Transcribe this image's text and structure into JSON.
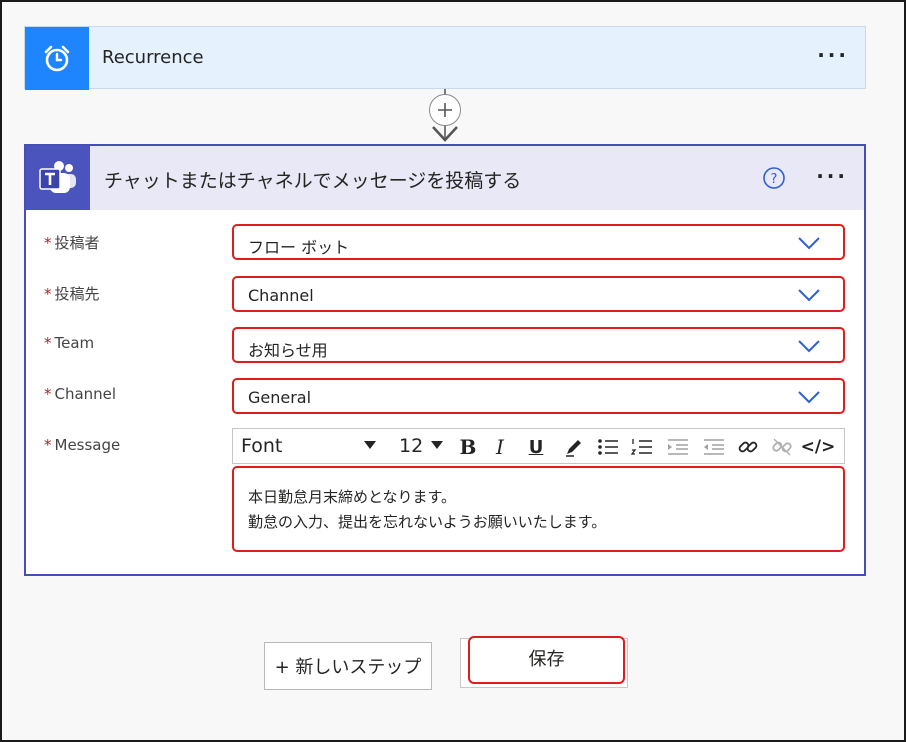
{
  "recurrence": {
    "title": "Recurrence",
    "menu": "···"
  },
  "teams_action": {
    "title": "チャットまたはチャネルでメッセージを投稿する",
    "menu": "···",
    "help": "?"
  },
  "fields": [
    {
      "label": "投稿者",
      "required": "*",
      "value": "フロー ボット"
    },
    {
      "label": "投稿先",
      "required": "*",
      "value": "Channel"
    },
    {
      "label": "Team",
      "required": "*",
      "value": "お知らせ用"
    },
    {
      "label": "Channel",
      "required": "*",
      "value": "General"
    }
  ],
  "message": {
    "label": "Message",
    "required": "*",
    "toolbar": {
      "font": "Font",
      "size": "12",
      "bold": "B",
      "italic": "I",
      "underline": "U",
      "code": "</>"
    },
    "lines": [
      "本日勤怠月末締めとなります。",
      "勤怠の入力、提出を忘れないようお願いいたします。"
    ]
  },
  "buttons": {
    "new_step": "+ 新しいステップ",
    "save": "保存"
  },
  "colors": {
    "recurrence_accent": "#1f85ff",
    "teams_accent": "#4b53bc",
    "highlight": "#e11c1c"
  }
}
